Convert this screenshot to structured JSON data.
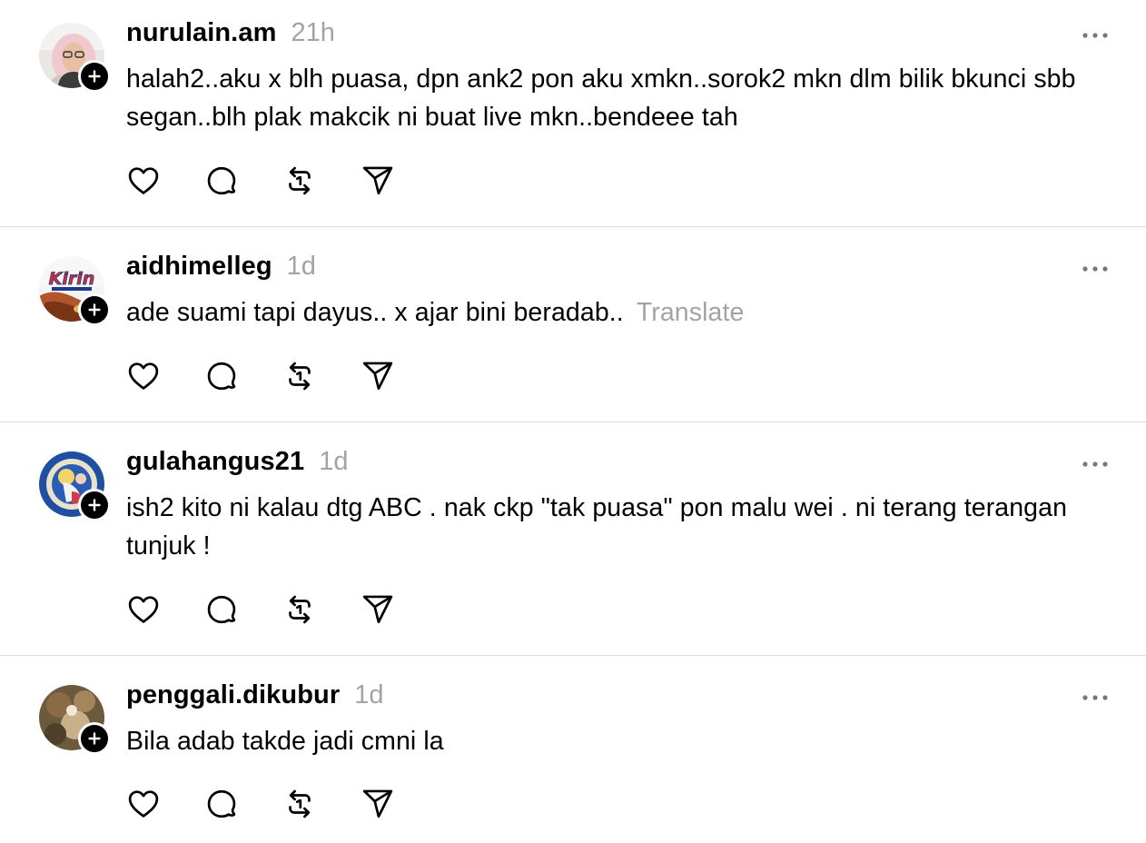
{
  "posts": [
    {
      "username": "nurulain.am",
      "time": "21h",
      "text": "halah2..aku x blh puasa, dpn ank2 pon aku xmkn..sorok2 mkn dlm bilik bkunci sbb segan..blh plak makcik ni buat live mkn..bendeee tah",
      "translate": ""
    },
    {
      "username": "aidhimelleg",
      "time": "1d",
      "text": "ade suami tapi dayus.. x ajar bini beradab..",
      "translate": "Translate"
    },
    {
      "username": "gulahangus21",
      "time": "1d",
      "text": "ish2 kito ni kalau dtg ABC . nak ckp \"tak puasa\" pon malu wei . ni terang terangan tunjuk !",
      "translate": ""
    },
    {
      "username": "penggali.dikubur",
      "time": "1d",
      "text": "Bila adab takde jadi cmni la",
      "translate": ""
    }
  ],
  "avatar_logo_text": "Kirin",
  "icons": {
    "follow": "plus-icon",
    "more": "more-horizontal-icon",
    "like": "heart-icon",
    "reply": "speech-bubble-icon",
    "repost": "repost-icon",
    "share": "paper-plane-icon"
  },
  "colors": {
    "text": "#000000",
    "muted": "#a3a3a3",
    "divider": "#d9d9d9",
    "icon": "#000000"
  }
}
